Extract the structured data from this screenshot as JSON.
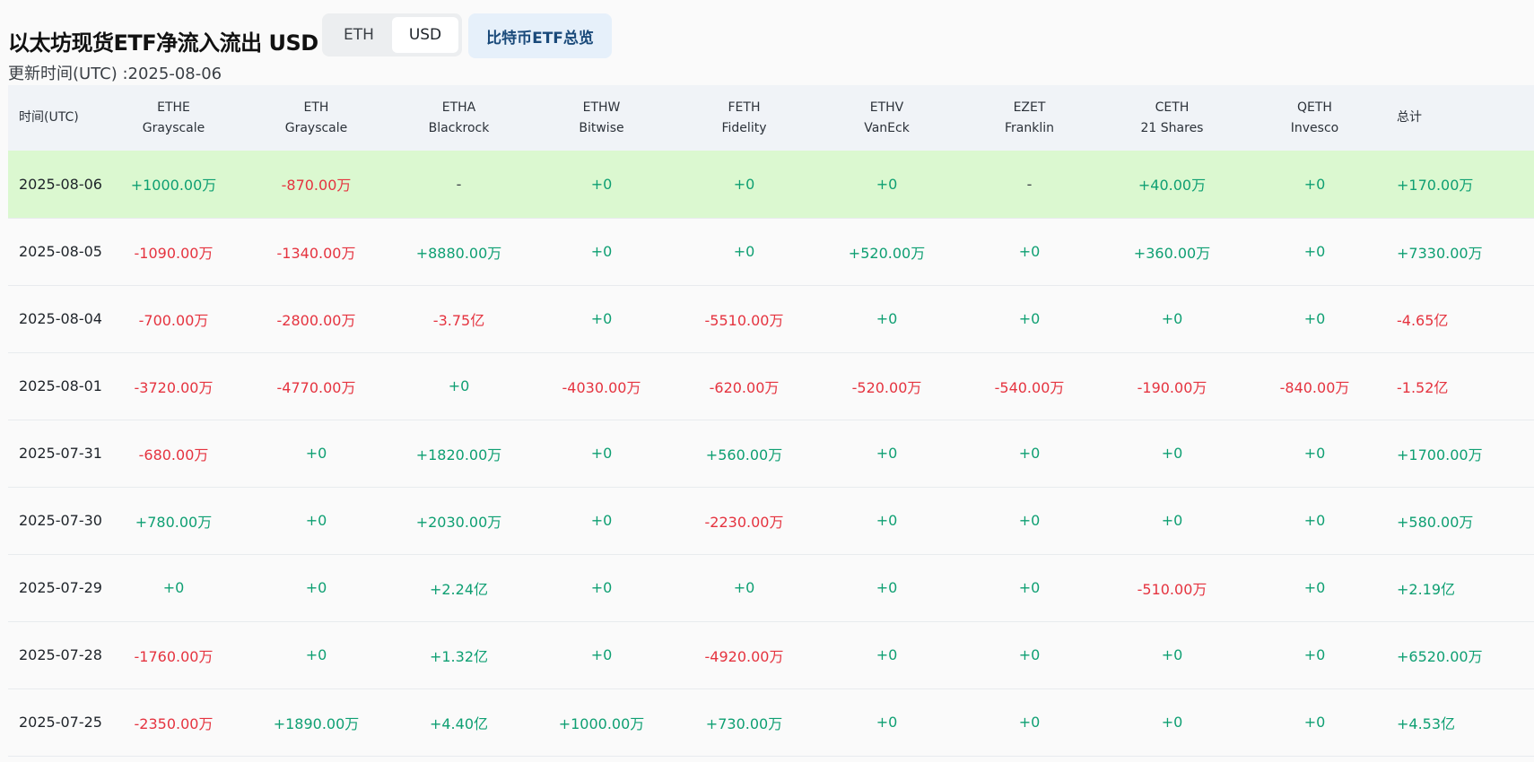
{
  "header": {
    "title": "以太坊现货ETF净流入流出 USD",
    "updated": "更新时间(UTC) :2025-08-06",
    "toggle": [
      "ETH",
      "USD"
    ],
    "active_toggle": "USD",
    "btc_link": "比特币ETF总览"
  },
  "colors": {
    "positive": "#0e9f72",
    "negative": "#e5333f",
    "highlight": "#dbf8d0"
  },
  "table": {
    "date_header": "时间(UTC)",
    "total_header": "总计",
    "columns": [
      {
        "ticker": "ETHE",
        "issuer": "Grayscale"
      },
      {
        "ticker": "ETH",
        "issuer": "Grayscale"
      },
      {
        "ticker": "ETHA",
        "issuer": "Blackrock"
      },
      {
        "ticker": "ETHW",
        "issuer": "Bitwise"
      },
      {
        "ticker": "FETH",
        "issuer": "Fidelity"
      },
      {
        "ticker": "ETHV",
        "issuer": "VanEck"
      },
      {
        "ticker": "EZET",
        "issuer": "Franklin"
      },
      {
        "ticker": "CETH",
        "issuer": "21 Shares"
      },
      {
        "ticker": "QETH",
        "issuer": "Invesco"
      }
    ],
    "rows": [
      {
        "date": "2025-08-06",
        "cells": [
          "+1000.00万",
          "-870.00万",
          "-",
          "+0",
          "+0",
          "+0",
          "-",
          "+40.00万",
          "+0"
        ],
        "total": "+170.00万"
      },
      {
        "date": "2025-08-05",
        "cells": [
          "-1090.00万",
          "-1340.00万",
          "+8880.00万",
          "+0",
          "+0",
          "+520.00万",
          "+0",
          "+360.00万",
          "+0"
        ],
        "total": "+7330.00万"
      },
      {
        "date": "2025-08-04",
        "cells": [
          "-700.00万",
          "-2800.00万",
          "-3.75亿",
          "+0",
          "-5510.00万",
          "+0",
          "+0",
          "+0",
          "+0"
        ],
        "total": "-4.65亿"
      },
      {
        "date": "2025-08-01",
        "cells": [
          "-3720.00万",
          "-4770.00万",
          "+0",
          "-4030.00万",
          "-620.00万",
          "-520.00万",
          "-540.00万",
          "-190.00万",
          "-840.00万"
        ],
        "total": "-1.52亿"
      },
      {
        "date": "2025-07-31",
        "cells": [
          "-680.00万",
          "+0",
          "+1820.00万",
          "+0",
          "+560.00万",
          "+0",
          "+0",
          "+0",
          "+0"
        ],
        "total": "+1700.00万"
      },
      {
        "date": "2025-07-30",
        "cells": [
          "+780.00万",
          "+0",
          "+2030.00万",
          "+0",
          "-2230.00万",
          "+0",
          "+0",
          "+0",
          "+0"
        ],
        "total": "+580.00万"
      },
      {
        "date": "2025-07-29",
        "cells": [
          "+0",
          "+0",
          "+2.24亿",
          "+0",
          "+0",
          "+0",
          "+0",
          "-510.00万",
          "+0"
        ],
        "total": "+2.19亿"
      },
      {
        "date": "2025-07-28",
        "cells": [
          "-1760.00万",
          "+0",
          "+1.32亿",
          "+0",
          "-4920.00万",
          "+0",
          "+0",
          "+0",
          "+0"
        ],
        "total": "+6520.00万"
      },
      {
        "date": "2025-07-25",
        "cells": [
          "-2350.00万",
          "+1890.00万",
          "+4.40亿",
          "+1000.00万",
          "+730.00万",
          "+0",
          "+0",
          "+0",
          "+0"
        ],
        "total": "+4.53亿"
      }
    ]
  }
}
